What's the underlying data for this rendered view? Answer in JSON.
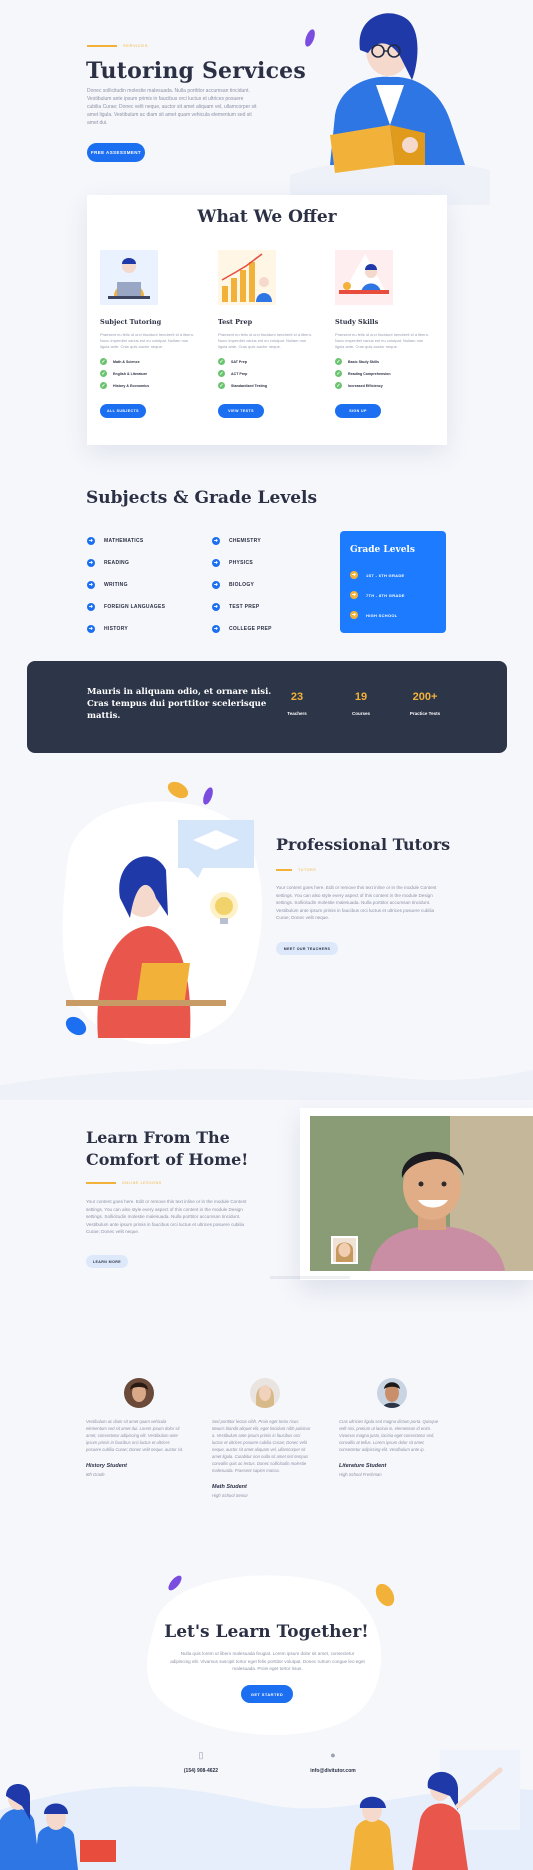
{
  "hero": {
    "eyebrow": "SERVICES",
    "title": "Tutoring Services",
    "body": "Donec sollicitudin molestie malesuada. Nulla porttitor accumsan tincidunt. Vestibulum ante ipsum primis in faucibus orci luctus et ultrices posuere cubilia Curae; Donec velit neque, auctor sit amet aliquam vel, ullamcorper sit amet ligula. Vestibulum ac diam sit amet quam vehicula elementum sed sit amet dui.",
    "button": "FREE ASSESSMENT"
  },
  "offer": {
    "title": "What We Offer",
    "columns": [
      {
        "title": "Subject Tutoring",
        "body": "Praesent eu felis id orci tincidunt hendrerit id a libero. Nunc imperdiet varius est eu volutpat. Nullam non ligula ante. Cras quis auctor neque.",
        "items": [
          "Math & Science",
          "English & Literature",
          "History & Economics"
        ],
        "button": "ALL SUBJECTS"
      },
      {
        "title": "Test Prep",
        "body": "Praesent eu felis id orci tincidunt hendrerit id a libero. Nunc imperdiet varius est eu volutpat. Nullam non ligula ante. Cras quis auctor neque.",
        "items": [
          "SAT Prep",
          "ACT Prep",
          "Standardized Testing"
        ],
        "button": "VIEW TESTS"
      },
      {
        "title": "Study Skills",
        "body": "Praesent eu felis id orci tincidunt hendrerit id a libero. Nunc imperdiet varius est eu volutpat. Nullam non ligula ante. Cras quis auctor neque.",
        "items": [
          "Basic Study Skills",
          "Reading Comprehension",
          "Increased Efficiency"
        ],
        "button": "SIGN UP"
      }
    ]
  },
  "subjects": {
    "title": "Subjects & Grade Levels",
    "left": [
      "MATHEMATICS",
      "READING",
      "WRITING",
      "FOREIGN LANGUAGES",
      "HISTORY"
    ],
    "right": [
      "CHEMISTRY",
      "PHYSICS",
      "BIOLOGY",
      "TEST PREP",
      "COLLEGE PREP"
    ],
    "grade_title": "Grade Levels",
    "grades": [
      "1ST - 6TH GRADE",
      "7TH - 8TH GRADE",
      "HIGH SCHOOL"
    ]
  },
  "stats": {
    "quote": "Mauris in aliquam odio, et ornare nisi. Cras tempus dui porttitor scelerisque mattis.",
    "items": [
      {
        "value": "23",
        "label": "Teachers"
      },
      {
        "value": "19",
        "label": "Courses"
      },
      {
        "value": "200+",
        "label": "Practice Tests"
      }
    ]
  },
  "tutors": {
    "title": "Professional Tutors",
    "eyebrow": "TUTORS",
    "body": "Your content goes here. Edit or remove this text inline or in the module Content settings. You can also style every aspect of this content in the module Design settings. Sollicitudin molestie malesuada. Nulla porttitor accumsan tincidunt. Vestibulum ante ipsum primis in faucibus orci luctus et ultrices posuere cubilia Curae; Donec velit neque.",
    "button": "MEET OUR TEACHERS"
  },
  "home": {
    "title": "Learn From The Comfort of Home!",
    "eyebrow": "ONLINE LESSONS",
    "body": "Your content goes here. Edit or remove this text inline or in the module Content settings. You can also style every aspect of this content in the module Design settings. Sollicitudin molestie malesuada. Nulla porttitor accumsan tincidunt. Vestibulum ante ipsum primis in faucibus orci luctus et ultrices posuere cubilia Curae; Donec velit neque.",
    "button": "LEARN MORE"
  },
  "testimonials": [
    {
      "body": "Vestibulum ac diam sit amet quam vehicula elementum sed sit amet dui. Lorem ipsum dolor sit amet, consectetur adipiscing elit. Vestibulum ante ipsum primis in faucibus orci luctus et ultrices posuere cubilia Curae; Donec velit neque, auctor sit.",
      "name": "History Student",
      "role": "8th Grade"
    },
    {
      "body": "Sed porttitor lectus nibh. Proin eget tortor risus. Mauris blandit aliquet elit, eget tincidunt nibh pulvinar a. Vestibulum ante ipsum primis in faucibus orci luctus et ultrices posuere cubilia Curae; Donec velit neque, auctor sit amet aliquam vel, ullamcorper sit amet ligula. Curabitur non nulla sit amet nisl tempus convallis quis ac lectus. Donec sollicitudin molestie malesuada. Praesent sapien massa.",
      "name": "Math Student",
      "role": "High School Senior"
    },
    {
      "body": "Cras ultricies ligula sed magna dictum porta. Quisque velit nisi, pretium ut lacinia in, elementum id enim. Vivamus magna justo, lacinia eget consectetur sed, convallis at tellus. Lorem ipsum dolor sit amet, consectetur adipiscing elit. Vestibulum ante ip.",
      "name": "Literature Student",
      "role": "High School Freshman"
    }
  ],
  "cta": {
    "title": "Let's Learn Together!",
    "body": "Nulla quis lorem ut libero malesuada feugiat. Lorem ipsum dolor sit amet, consectetur adipiscing elit. Vivamus suscipit tortor eget felis porttitor volutpat. Donec rutrum congue leo eget malesuada. Proin eget tortor risus.",
    "button": "GET STARTED",
    "phone": "(154) 908-4622",
    "email": "info@divitutor.com"
  },
  "colors": {
    "primary": "#1d6ff2",
    "accent": "#f2b23a",
    "dark": "#2d3648",
    "check": "#6ac36f"
  }
}
